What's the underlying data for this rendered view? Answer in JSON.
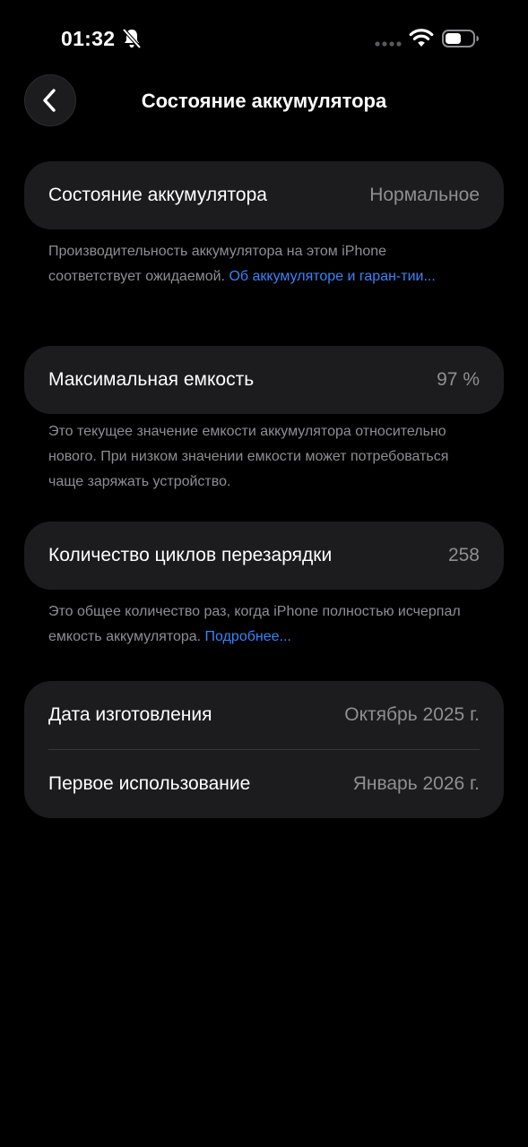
{
  "status_bar": {
    "time": "01:32",
    "icons": [
      "bell-slash-icon",
      "signal-icon",
      "wifi-icon",
      "battery-icon"
    ]
  },
  "nav": {
    "title": "Состояние аккумулятора",
    "back_icon": "chevron-left-icon"
  },
  "health": {
    "label": "Состояние аккумулятора",
    "value": "Нормальное",
    "footnote_text": "Производительность аккумулятора на этом iPhone соответствует ожидаемой. ",
    "footnote_link": "Об аккумуляторе и гаран-тии..."
  },
  "capacity": {
    "label": "Максимальная емкость",
    "value": "97 %",
    "footnote_text": "Это текущее значение емкости аккумулятора относительно нового. При низком значении емкости может потребоваться чаще заряжать устройство."
  },
  "cycles": {
    "label": "Количество циклов перезарядки",
    "value": "258",
    "footnote_text": "Это общее количество раз, когда iPhone полностью исчерпал емкость аккумулятора. ",
    "footnote_link": "Подробнее..."
  },
  "dates": {
    "manufacture_label": "Дата изготовления",
    "manufacture_value": "Октябрь 2025 г.",
    "first_use_label": "Первое использование",
    "first_use_value": "Январь 2026 г."
  },
  "colors": {
    "background": "#000000",
    "card": "#1c1c1e",
    "secondary_text": "#8e8e93",
    "link": "#3b82f6"
  }
}
